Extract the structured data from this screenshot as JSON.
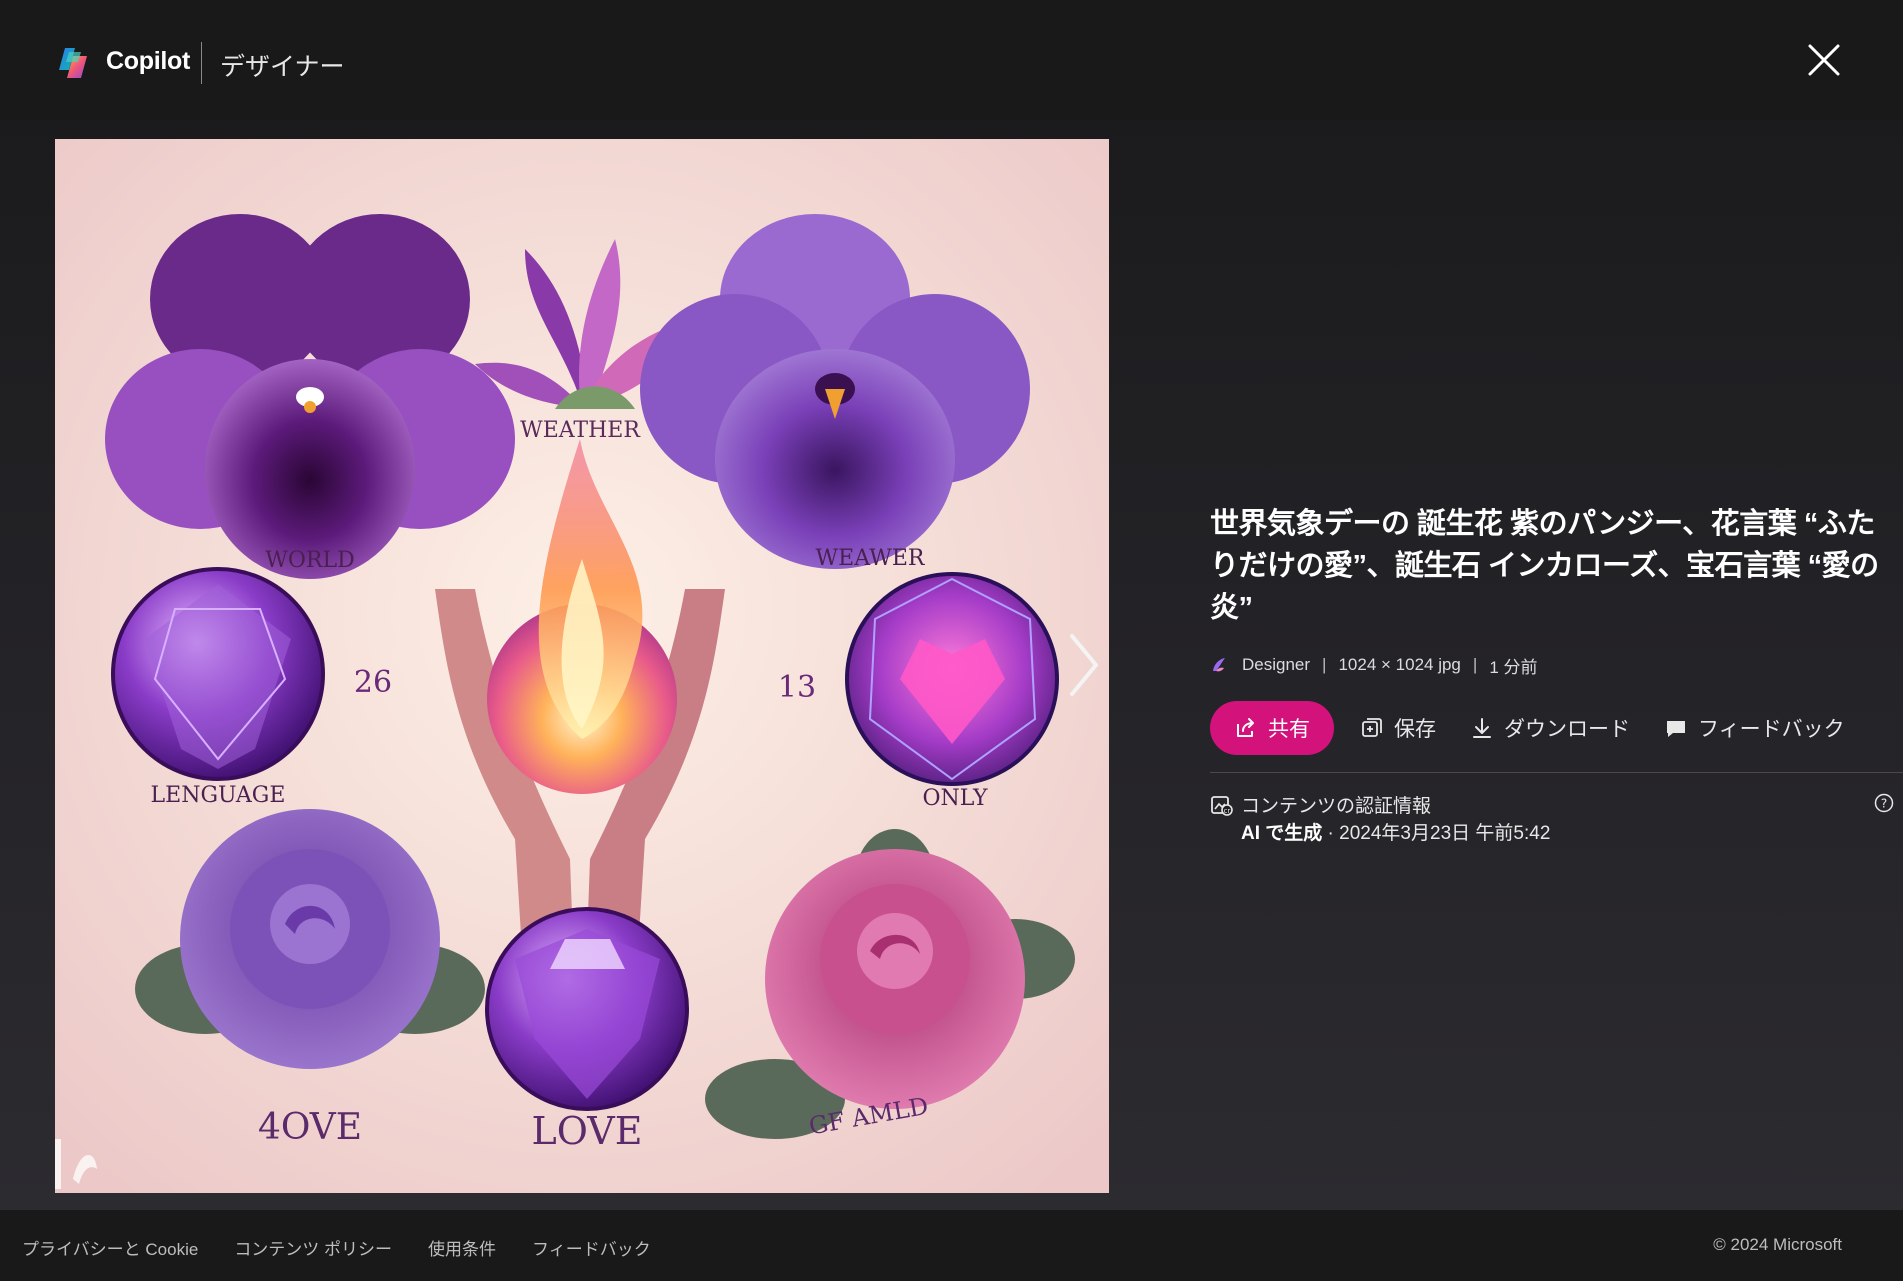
{
  "header": {
    "brand": "Copilot",
    "subtitle": "デザイナー",
    "close_icon": "close-icon"
  },
  "image": {
    "labels": {
      "top_center": "WEATHER",
      "top_left": "WORLD",
      "top_right": "WEAWER",
      "mid_left_num": "26",
      "mid_right_num": "13",
      "mid_left": "LENGUAGE",
      "mid_right": "ONLY",
      "bottom_left": "4OVE",
      "bottom_center": "LOVE",
      "bottom_right": "GF AMLD"
    },
    "next_icon": "chevron-right-icon"
  },
  "details": {
    "title": "世界気象デーの 誕生花 紫のパンジー、花言葉 “ふたりだけの愛”、誕生石 インカローズ、宝石言葉 “愛の炎”",
    "meta": {
      "source": "Designer",
      "dimensions": "1024 × 1024 jpg",
      "time": "1 分前"
    },
    "actions": {
      "share": "共有",
      "save": "保存",
      "download": "ダウンロード",
      "feedback": "フィードバック"
    },
    "credentials": {
      "title": "コンテンツの認証情報",
      "ai_label": "AI で生成",
      "date": " · 2024年3月23日 午前5:42"
    }
  },
  "footer": {
    "links": [
      "プライバシーと Cookie",
      "コンテンツ ポリシー",
      "使用条件",
      "フィードバック"
    ],
    "copyright": "© 2024 Microsoft"
  },
  "colors": {
    "accent": "#d4127c",
    "background": "#1f1f21",
    "header": "#191919"
  }
}
